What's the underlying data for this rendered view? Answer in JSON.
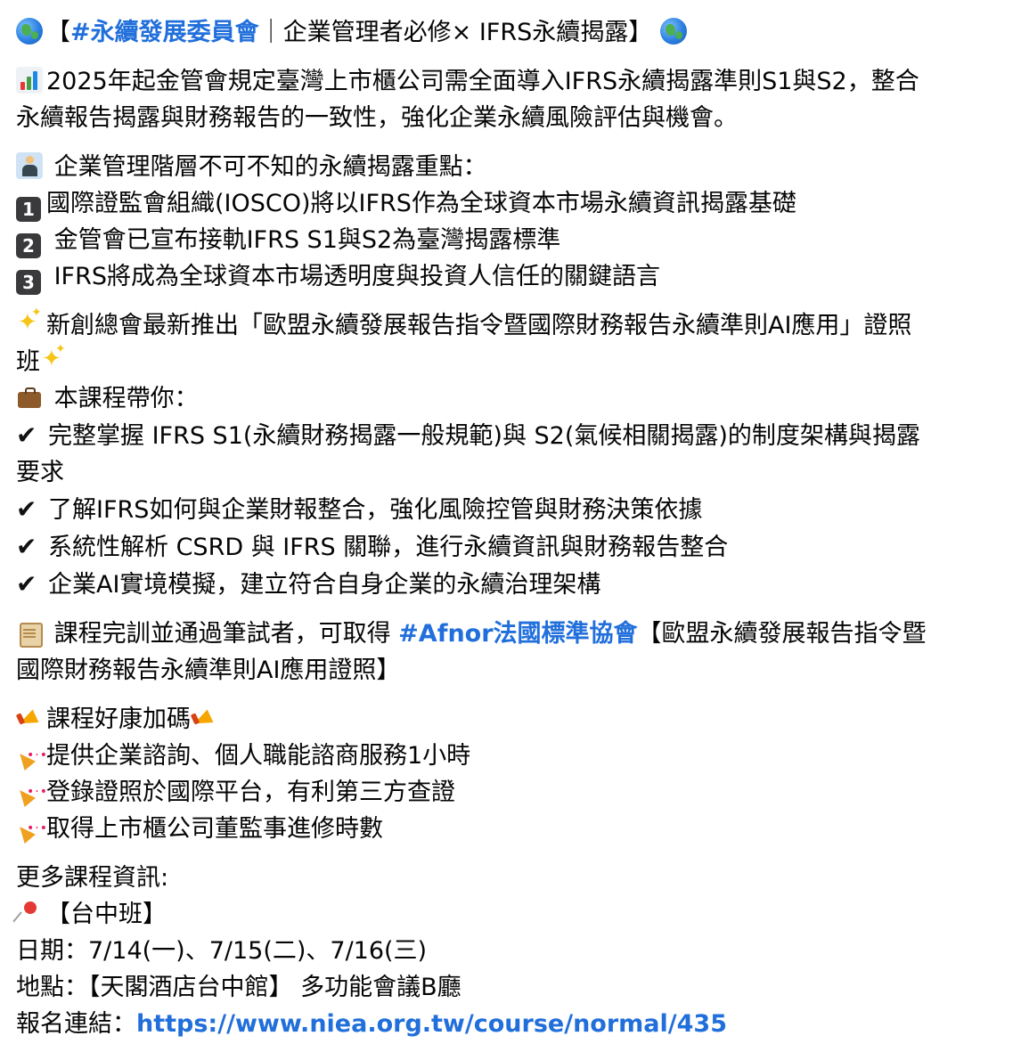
{
  "post": {
    "title_prefix": "【",
    "title_hashtag": "#永續發展委員會",
    "title_rest": "｜企業管理者必修× IFRS永續揭露】",
    "intro_line1": "2025年起金管會規定臺灣上市櫃公司需全面導入IFRS永續揭露準則S1與S2，整合",
    "intro_line2": "永續報告揭露與財務報告的一致性，強化企業永續風險評估與機會。",
    "key_points_heading": " 企業管理階層不可不知的永續揭露重點：",
    "key_points": [
      {
        "num": "1",
        "text": "國際證監會組織(IOSCO)將以IFRS作為全球資本市場永續資訊揭露基礎"
      },
      {
        "num": "2",
        "text": " 金管會已宣布接軌IFRS S1與S2為臺灣揭露標準"
      },
      {
        "num": "3",
        "text": " IFRS將成為全球資本市場透明度與投資人信任的關鍵語言"
      }
    ],
    "course_line1": "新創總會最新推出「歐盟永續發展報告指令暨國際財務報告永續準則AI應用」證照",
    "course_line2": "班",
    "course_brings_heading": " 本課程帶你：",
    "course_items": [
      {
        "line1": "完整掌握 IFRS S1(永續財務揭露一般規範)與 S2(氣候相關揭露)的制度架構與揭露",
        "line2": "要求"
      },
      {
        "line1": "了解IFRS如何與企業財報整合，強化風險控管與財務決策依據",
        "line2": ""
      },
      {
        "line1": "系統性解析 CSRD 與 IFRS 關聯，進行永續資訊與財務報告整合",
        "line2": ""
      },
      {
        "line1": "企業AI實境模擬，建立符合自身企業的永續治理架構",
        "line2": ""
      }
    ],
    "cert_text_a": " 課程完訓並通過筆試者，可取得 ",
    "cert_hashtag": "#Afnor法國標準協會",
    "cert_text_b": "【歐盟永續發展報告指令暨",
    "cert_line2": "國際財務報告永續準則AI應用證照】",
    "bonus_heading": "課程好康加碼",
    "bonus_items": [
      "提供企業諮詢、個人職能諮商服務1小時",
      "登錄證照於國際平台，有利第三方查證",
      "取得上市櫃公司董監事進修時數"
    ],
    "more_info": "更多課程資訊:",
    "location_tag": "【台中班】",
    "date_line": "日期：7/14(一)、7/15(二)、7/16(三)",
    "venue_line": "地點：【天閣酒店台中館】 多功能會議B廳",
    "signup_label": "報名連結：",
    "signup_url": "https://www.niea.org.tw/course/normal/435"
  },
  "icons": {
    "title": "globe-icon",
    "intro": "bar-chart-icon",
    "heading": "businessman-icon",
    "sparkle": "sparkles-icon",
    "briefcase": "briefcase-icon",
    "check": "check-mark-icon",
    "scroll": "scroll-icon",
    "megaphone": "megaphone-icon",
    "party": "party-popper-icon",
    "pin": "round-pushpin-icon"
  },
  "colors": {
    "text": "#050505",
    "link": "#216fdb",
    "background": "#ffffff"
  }
}
